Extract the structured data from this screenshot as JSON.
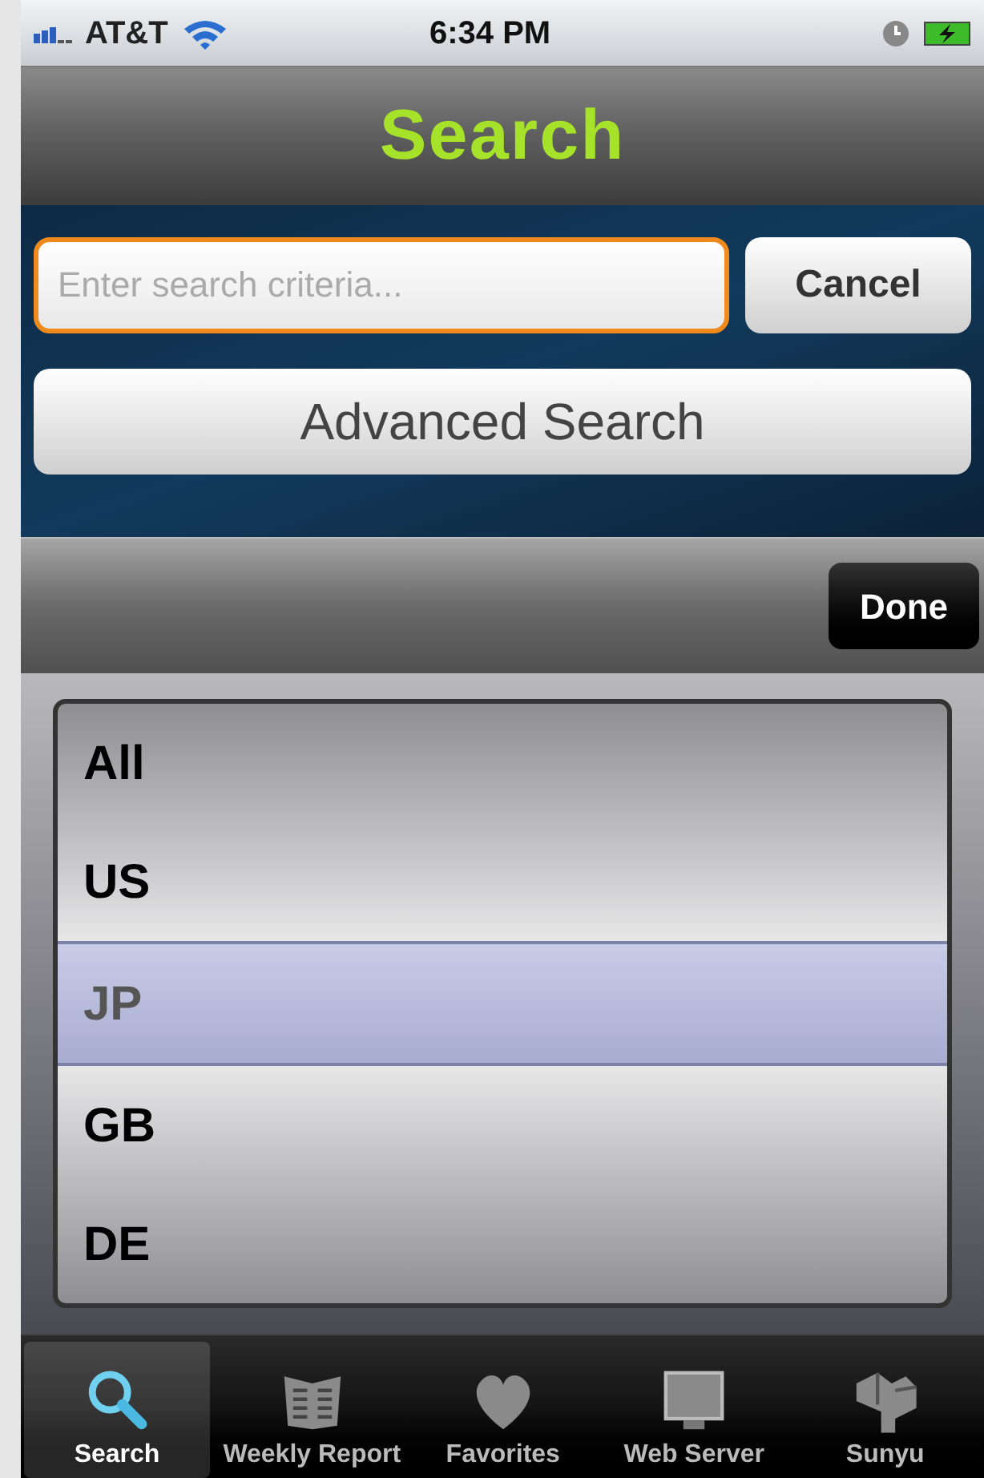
{
  "status_bar": {
    "carrier": "AT&T",
    "time": "6:34 PM"
  },
  "nav_bar": {
    "title": "Search"
  },
  "search": {
    "placeholder": "Enter search criteria...",
    "cancel": "Cancel",
    "advanced": "Advanced Search"
  },
  "toolbar": {
    "done": "Done"
  },
  "picker": [
    {
      "label": "All",
      "selected": false
    },
    {
      "label": "US",
      "selected": false
    },
    {
      "label": "JP",
      "selected": true
    },
    {
      "label": "GB",
      "selected": false
    },
    {
      "label": "DE",
      "selected": false
    }
  ],
  "tab_bar": [
    {
      "label": "Search",
      "kind": "search",
      "selected": true
    },
    {
      "label": "Weekly Report",
      "kind": "newspaper",
      "selected": false
    },
    {
      "label": "Favorites",
      "kind": "heart",
      "selected": false
    },
    {
      "label": "Web Server",
      "kind": "monitor",
      "selected": false
    },
    {
      "label": "Sunyu",
      "kind": "cube",
      "selected": false
    }
  ]
}
